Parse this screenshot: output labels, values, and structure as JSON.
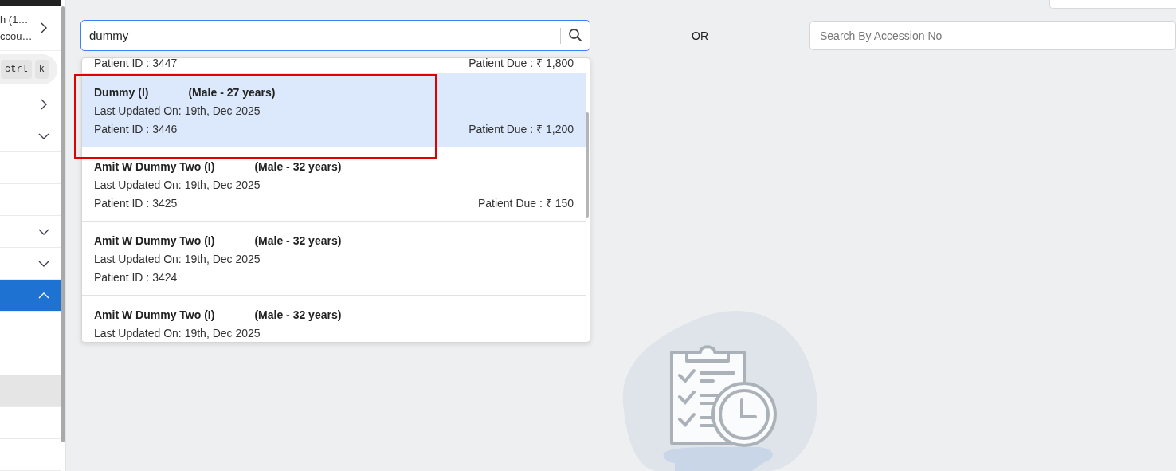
{
  "sidebar": {
    "header": {
      "lines": [
        "h (1…",
        "ccou…"
      ]
    },
    "shortcut_keys": [
      "ctrl",
      "k"
    ],
    "items": [
      {
        "kind": "link",
        "selected": false,
        "highlighted": false
      },
      {
        "kind": "group",
        "expanded": false,
        "selected": false,
        "highlighted": false
      },
      {
        "kind": "plain",
        "selected": false,
        "highlighted": false
      },
      {
        "kind": "plain",
        "selected": false,
        "highlighted": false
      },
      {
        "kind": "group",
        "expanded": false,
        "selected": false,
        "highlighted": false
      },
      {
        "kind": "group",
        "expanded": false,
        "selected": false,
        "highlighted": false
      },
      {
        "kind": "group",
        "expanded": true,
        "selected": true,
        "highlighted": false
      },
      {
        "kind": "plain",
        "selected": false,
        "highlighted": false
      },
      {
        "kind": "plain",
        "selected": false,
        "highlighted": false
      },
      {
        "kind": "plain",
        "selected": false,
        "highlighted": true
      },
      {
        "kind": "plain",
        "selected": false,
        "highlighted": false
      },
      {
        "kind": "plain",
        "selected": false,
        "highlighted": false
      }
    ]
  },
  "search": {
    "value": "dummy"
  },
  "separator": "OR",
  "accession_search": {
    "placeholder": "Search By Accession No"
  },
  "results": [
    {
      "patient_id": "Patient ID : 3447",
      "due": "Patient Due : ₹ 1,800",
      "selected": false
    },
    {
      "name": "Dummy (I)",
      "info": "(Male - 27 years)",
      "updated": "Last Updated On: 19th, Dec 2025",
      "patient_id": "Patient ID : 3446",
      "due": "Patient Due : ₹ 1,200",
      "selected": true
    },
    {
      "name": "Amit W Dummy Two (I)",
      "info": "(Male - 32 years)",
      "updated": "Last Updated On: 19th, Dec 2025",
      "patient_id": "Patient ID : 3425",
      "due": "Patient Due : ₹ 150",
      "selected": false
    },
    {
      "name": "Amit W Dummy Two (I)",
      "info": "(Male - 32 years)",
      "updated": "Last Updated On: 19th, Dec 2025",
      "patient_id": "Patient ID : 3424",
      "selected": false
    },
    {
      "name": "Amit W Dummy Two (I)",
      "info": "(Male - 32 years)",
      "updated": "Last Updated On: 19th, Dec 2025",
      "selected": false
    }
  ]
}
